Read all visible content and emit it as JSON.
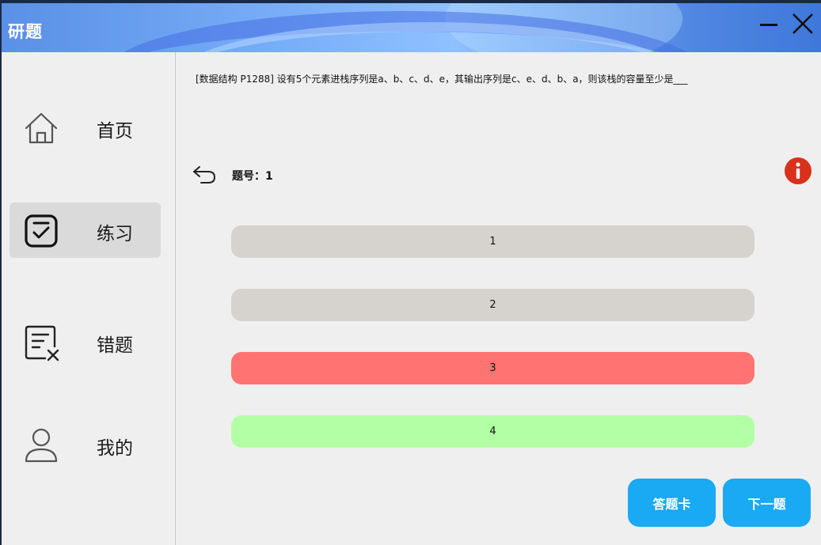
{
  "window": {
    "title": "研题"
  },
  "sidebar": {
    "items": [
      {
        "label": "首页",
        "icon": "home-icon",
        "active": false
      },
      {
        "label": "练习",
        "icon": "practice-check-icon",
        "active": true
      },
      {
        "label": "错题",
        "icon": "wrong-questions-icon",
        "active": false
      },
      {
        "label": "我的",
        "icon": "user-icon",
        "active": false
      }
    ]
  },
  "question": {
    "text": "[数据结构 P1288] 设有5个元素进栈序列是a、b、c、d、e，其输出序列是c、e、d、b、a，则该栈的容量至少是___",
    "number_label": "题号：1"
  },
  "options": [
    {
      "label": "1",
      "state": "neutral",
      "color": "#d6d3ce"
    },
    {
      "label": "2",
      "state": "neutral",
      "color": "#d6d3ce"
    },
    {
      "label": "3",
      "state": "wrong",
      "color": "#ff7373"
    },
    {
      "label": "4",
      "state": "correct",
      "color": "#b3ffa6"
    }
  ],
  "actions": {
    "answer_card": "答题卡",
    "next": "下一题"
  },
  "colors": {
    "accent": "#1aa9f3",
    "info": "#d9311c",
    "active_nav": "#dadada"
  }
}
